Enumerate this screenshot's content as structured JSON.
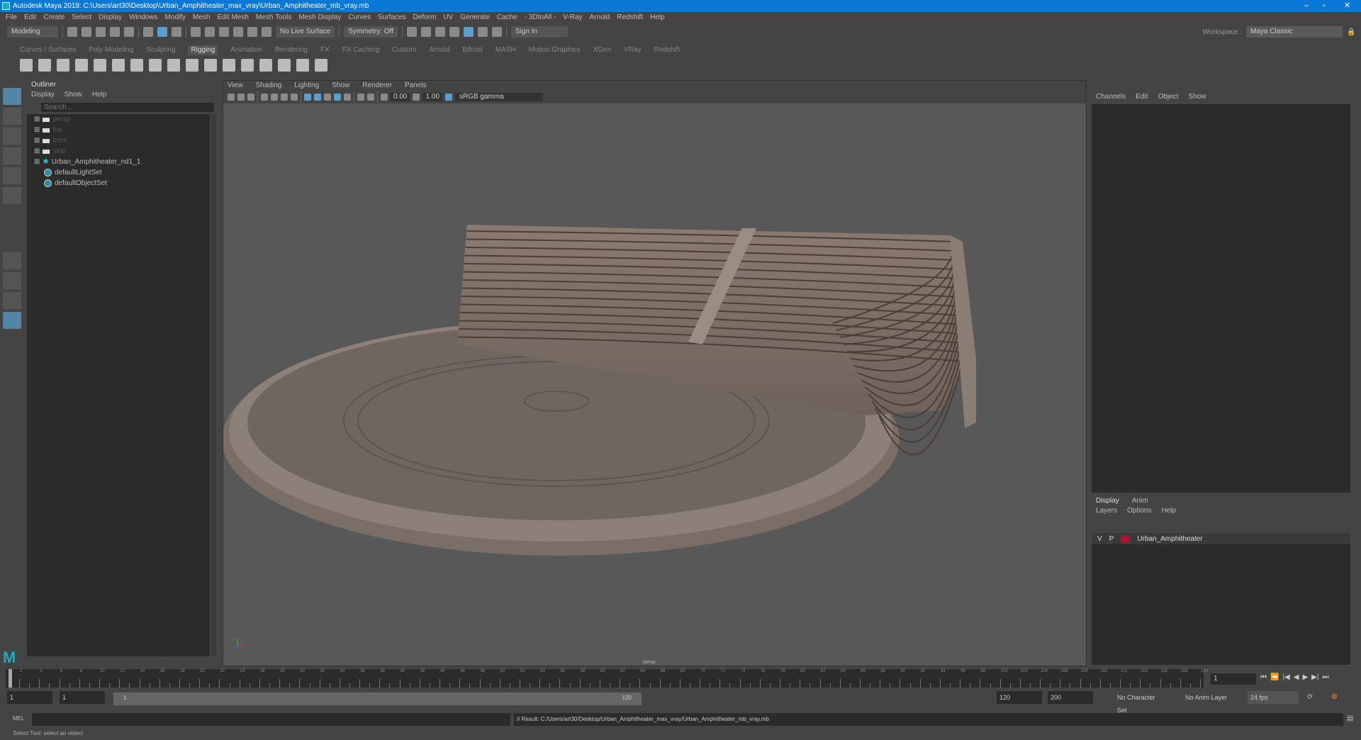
{
  "title": "Autodesk Maya 2018: C:\\Users\\art30\\Desktop\\Urban_Amphitheater_max_vray\\Urban_Amphitheater_mb_vray.mb",
  "menu": [
    "File",
    "Edit",
    "Create",
    "Select",
    "Display",
    "Windows",
    "Modify",
    "Mesh",
    "Edit Mesh",
    "Mesh Tools",
    "Mesh Display",
    "Curves",
    "Surfaces",
    "Deform",
    "UV",
    "Generate",
    "Cache",
    "- 3DtoAll -",
    "V-Ray",
    "Arnold",
    "Redshift",
    "Help"
  ],
  "toolbar": {
    "mode": "Modeling",
    "live_surface": "No Live Surface",
    "symmetry": "Symmetry: Off",
    "sign_in": "Sign In",
    "workspace_label": "Workspace :",
    "workspace": "Maya Classic"
  },
  "shelf_tabs": [
    "Curves / Surfaces",
    "Poly Modeling",
    "Sculpting",
    "Rigging",
    "Animation",
    "Rendering",
    "FX",
    "FX Caching",
    "Custom",
    "Arnold",
    "Bifrost",
    "MASH",
    "Motion Graphics",
    "XGen",
    "VRay",
    "Redshift"
  ],
  "outliner": {
    "title": "Outliner",
    "menu": [
      "Display",
      "Show",
      "Help"
    ],
    "search_placeholder": "Search...",
    "items": [
      "persp",
      "top",
      "front",
      "side",
      "Urban_Amphitheater_nd1_1",
      "defaultLightSet",
      "defaultObjectSet"
    ]
  },
  "viewport": {
    "menu": [
      "View",
      "Shading",
      "Lighting",
      "Show",
      "Renderer",
      "Panels"
    ],
    "exposure": "0.00",
    "gamma": "1.00",
    "color_space": "sRGB gamma",
    "camera": "persp"
  },
  "channel_box": {
    "menu": [
      "Channels",
      "Edit",
      "Object",
      "Show"
    ]
  },
  "layers": {
    "tabs": [
      "Display",
      "Anim"
    ],
    "menu": [
      "Layers",
      "Options",
      "Help"
    ],
    "layer": {
      "v": "V",
      "p": "P",
      "name": "Urban_Amphitheater",
      "color": "#b01030"
    }
  },
  "timeline": {
    "start": 1,
    "end": 120,
    "current": "1"
  },
  "range": {
    "start": "1",
    "playback_start": "1",
    "slider_start": "1",
    "slider_end": "120",
    "playback_end": "120",
    "end": "200",
    "character_set": "No Character Set",
    "anim_layer": "No Anim Layer",
    "fps": "24 fps"
  },
  "mel": {
    "label": "MEL",
    "result": "// Result: C:/Users/art30/Desktop/Urban_Amphitheater_max_vray/Urban_Amphitheater_mb_vray.mb"
  },
  "help_line": "Select Tool: select an object"
}
